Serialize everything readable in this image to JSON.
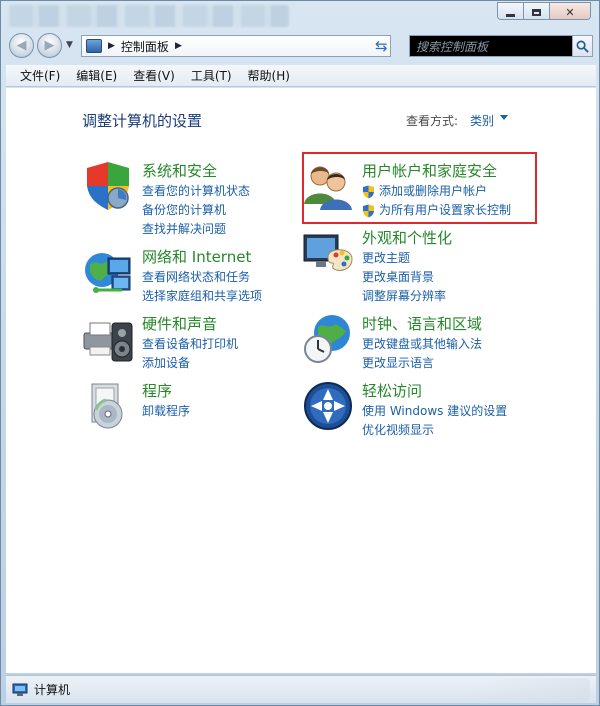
{
  "window": {
    "caption_buttons": [
      "minimize",
      "maximize",
      "close"
    ]
  },
  "navigation": {
    "address_path": "控制面板",
    "search_placeholder": "搜索控制面板"
  },
  "menu": [
    "文件(F)",
    "编辑(E)",
    "查看(V)",
    "工具(T)",
    "帮助(H)"
  ],
  "content": {
    "title": "调整计算机的设置",
    "view_by_label": "查看方式:",
    "view_by_value": "类别",
    "categories": [
      {
        "id": "system-security",
        "title": "系统和安全",
        "icon": "shield-icon",
        "links": [
          "查看您的计算机状态",
          "备份您的计算机",
          "查找并解决问题"
        ]
      },
      {
        "id": "network-internet",
        "title": "网络和 Internet",
        "icon": "network-globe-icon",
        "links": [
          "查看网络状态和任务",
          "选择家庭组和共享选项"
        ]
      },
      {
        "id": "hardware-sound",
        "title": "硬件和声音",
        "icon": "printer-speaker-icon",
        "links": [
          "查看设备和打印机",
          "添加设备"
        ]
      },
      {
        "id": "programs",
        "title": "程序",
        "icon": "programs-disc-icon",
        "links": [
          "卸载程序"
        ]
      },
      {
        "id": "user-accounts",
        "title": "用户帐户和家庭安全",
        "icon": "users-icon",
        "links": [
          "添加或删除用户帐户",
          "为所有用户设置家长控制"
        ],
        "highlighted": true
      },
      {
        "id": "appearance",
        "title": "外观和个性化",
        "icon": "monitor-palette-icon",
        "links": [
          "更改主题",
          "更改桌面背景",
          "调整屏幕分辨率"
        ]
      },
      {
        "id": "clock-language",
        "title": "时钟、语言和区域",
        "icon": "globe-clock-icon",
        "links": [
          "更改键盘或其他输入法",
          "更改显示语言"
        ]
      },
      {
        "id": "ease-of-access",
        "title": "轻松访问",
        "icon": "ease-of-access-icon",
        "links": [
          "使用 Windows 建议的设置",
          "优化视频显示"
        ]
      }
    ]
  },
  "statusbar": {
    "text": "计算机"
  },
  "colors": {
    "category_title": "#26882b",
    "link": "#1b5fa9",
    "page_title": "#1b3d7a",
    "highlight_border": "#e0282f"
  }
}
